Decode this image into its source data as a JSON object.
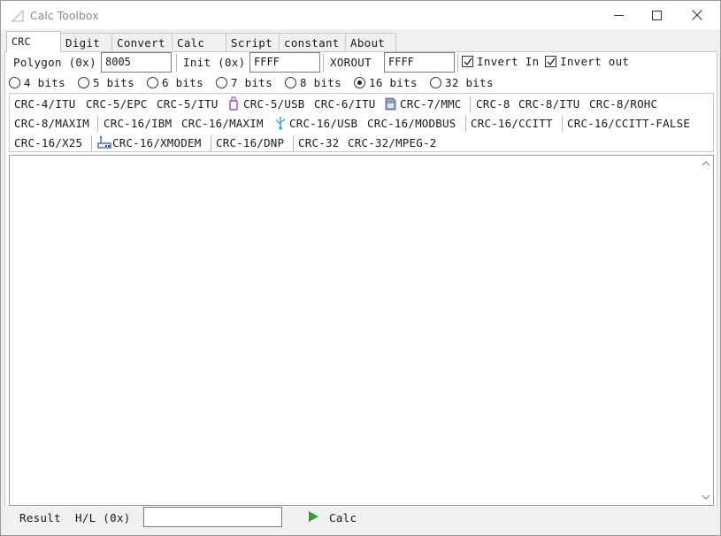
{
  "window": {
    "title": "Calc Toolbox",
    "icons": {
      "app": "app-icon",
      "minimize": "minimize-icon",
      "maximize": "maximize-icon",
      "close": "close-icon"
    }
  },
  "tabs": [
    {
      "label": "CRC",
      "active": true
    },
    {
      "label": "Digit"
    },
    {
      "label": "Convert"
    },
    {
      "label": "Calc"
    },
    {
      "label": "Script"
    },
    {
      "label": "constant"
    },
    {
      "label": "About"
    }
  ],
  "params": {
    "polygon_label": "Polygon (0x)",
    "polygon_value": "8005",
    "init_label": "Init (0x)",
    "init_value": "FFFF",
    "xorout_label": "XOROUT",
    "xorout_value": "FFFF",
    "invert_in_label": "Invert In",
    "invert_in_checked": true,
    "invert_out_label": "Invert out",
    "invert_out_checked": true
  },
  "bits": {
    "options": [
      "4 bits",
      "5 bits",
      "6 bits",
      "7 bits",
      "8 bits",
      "16 bits",
      "32 bits"
    ],
    "selected": "16 bits"
  },
  "presets": {
    "row1": [
      "CRC-4/ITU",
      "CRC-5/EPC",
      "CRC-5/ITU",
      "CRC-5/USB",
      "CRC-6/ITU",
      "CRC-7/MMC",
      "CRC-8",
      "CRC-8/ITU",
      "CRC-8/ROHC"
    ],
    "row2": [
      "CRC-8/MAXIM",
      "CRC-16/IBM",
      "CRC-16/MAXIM",
      "CRC-16/USB",
      "CRC-16/MODBUS",
      "CRC-16/CCITT",
      "CRC-16/CCITT-FALSE"
    ],
    "row3": [
      "CRC-16/X25",
      "CRC-16/XMODEM",
      "CRC-16/DNP",
      "CRC-32",
      "CRC-32/MPEG-2"
    ]
  },
  "output": {
    "text": ""
  },
  "result": {
    "label": "Result",
    "hl_label": "H/L (0x)",
    "value": "",
    "calc_label": "Calc"
  },
  "colors": {
    "accent_green": "#2aa52a",
    "usb_cyan": "#1aa7c9",
    "usb_purple": "#8a2fc9",
    "xmodem_blue": "#1a4fb8"
  }
}
